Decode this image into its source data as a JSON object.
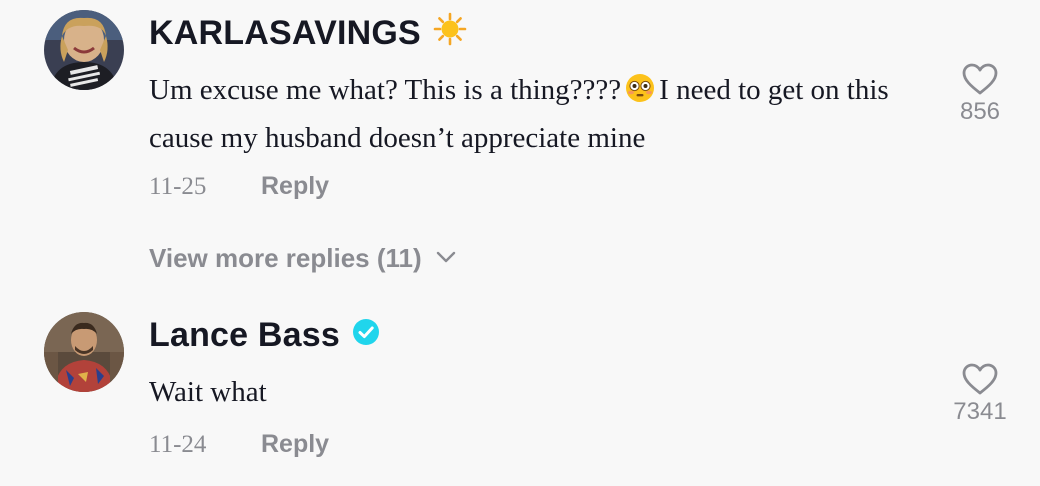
{
  "comments": [
    {
      "username": "KARLASAVINGS",
      "username_emoji": "sun-emoji",
      "text_before_emoji": "Um excuse me what? This is a thing????",
      "inline_emoji": "flushed-face-emoji",
      "text_after_emoji": "I need to get on this cause my husband doesn’t appreciate mine",
      "date": "11-25",
      "reply_label": "Reply",
      "like_count": "856",
      "liked": false
    },
    {
      "username": "Lance Bass",
      "verified": true,
      "text": "Wait what",
      "date": "11-24",
      "reply_label": "Reply",
      "like_count": "7341",
      "liked": false
    }
  ],
  "view_more": {
    "label": "View more replies (11)",
    "icon": "chevron-down-icon"
  },
  "colors": {
    "background": "#f8f8f8",
    "text_primary": "#161823",
    "text_secondary": "#8a8b91",
    "verified_badge": "#20d5ec"
  }
}
